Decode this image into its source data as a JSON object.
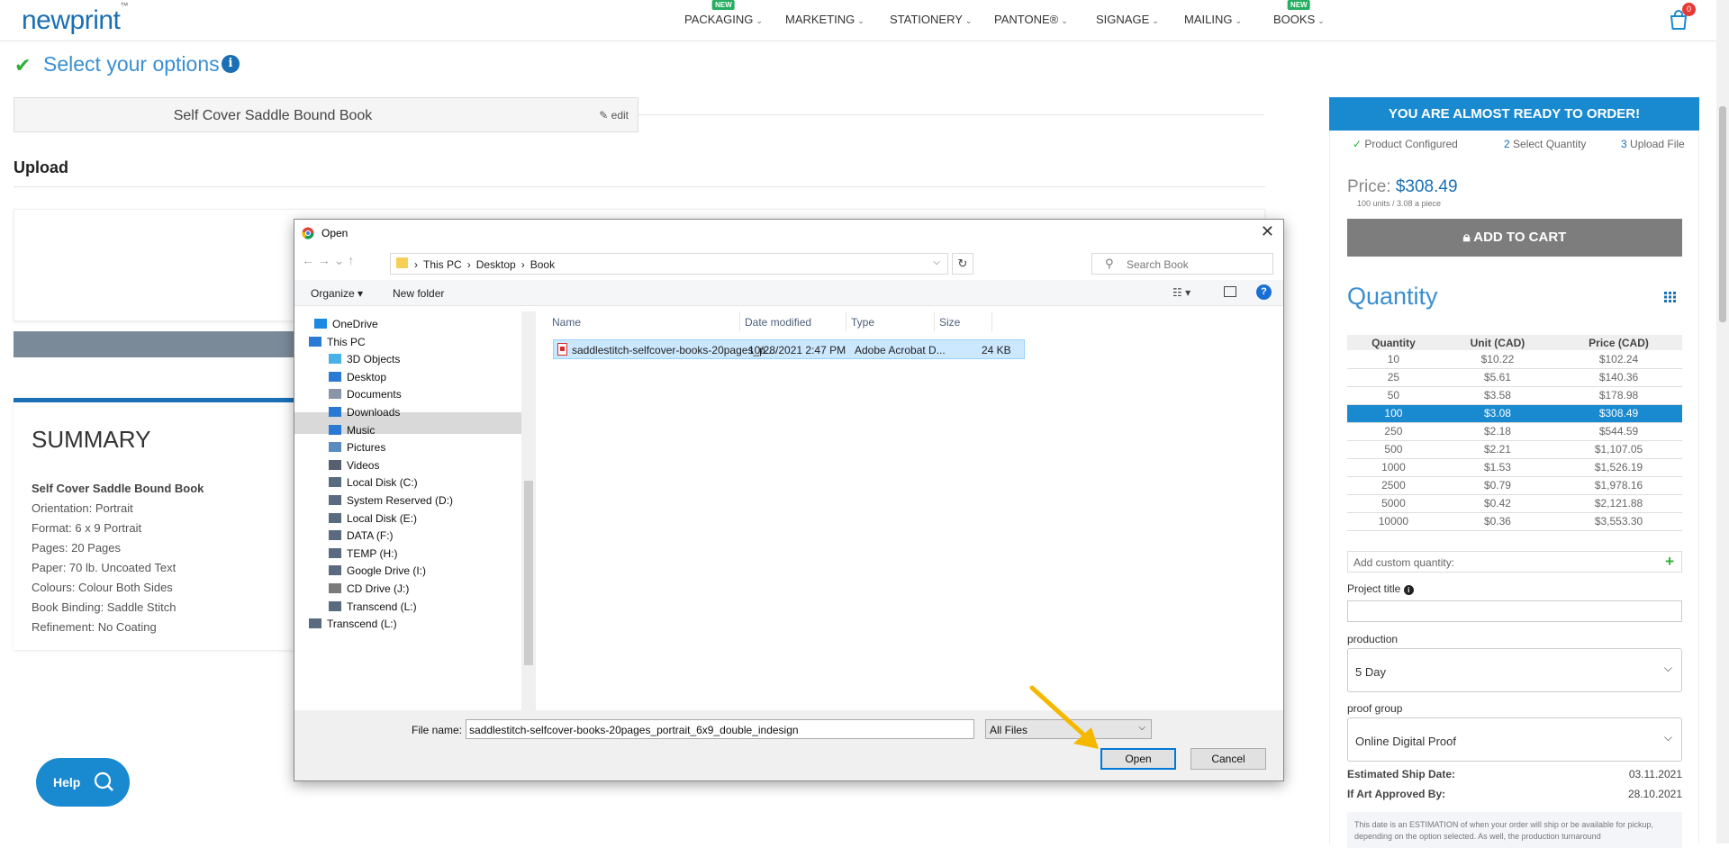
{
  "header": {
    "logo": "newprint",
    "logo_tm": "™",
    "nav": [
      {
        "label": "PACKAGING",
        "badge": "NEW"
      },
      {
        "label": "MARKETING",
        "badge": ""
      },
      {
        "label": "STATIONERY",
        "badge": ""
      },
      {
        "label": "PANTONE®",
        "badge": ""
      },
      {
        "label": "SIGNAGE",
        "badge": ""
      },
      {
        "label": "MAILING",
        "badge": ""
      },
      {
        "label": "BOOKS",
        "badge": "NEW"
      }
    ],
    "cart_count": "0",
    "chevron": "⌄"
  },
  "options": {
    "title": "Select your options",
    "info_glyph": "i",
    "product_name": "Self Cover Saddle Bound Book",
    "edit_label": "edit"
  },
  "upload": {
    "heading": "Upload"
  },
  "summary": {
    "heading": "SUMMARY",
    "lines": [
      "Self Cover Saddle Bound Book",
      "Orientation: Portrait",
      "Format: 6 x 9 Portrait",
      "Pages: 20 Pages",
      "Paper: 70 lb. Uncoated Text",
      "Colours: Colour Both Sides",
      "Book Binding: Saddle Stitch",
      "Refinement: No Coating"
    ]
  },
  "help": {
    "label": "Help"
  },
  "order": {
    "banner": "YOU ARE ALMOST READY TO ORDER!",
    "steps": [
      {
        "num": "✓",
        "label": "Product Configured"
      },
      {
        "num": "2",
        "label": "Select Quantity"
      },
      {
        "num": "3",
        "label": "Upload File"
      }
    ],
    "price_label": "Price:",
    "price_value": "$308.49",
    "price_sub": "100 units / 3.08 a piece",
    "add_to_cart": "ADD TO CART",
    "quantity_heading": "Quantity",
    "table_headers": [
      "Quantity",
      "Unit (CAD)",
      "Price (CAD)"
    ],
    "table_rows": [
      [
        "10",
        "$10.22",
        "$102.24"
      ],
      [
        "25",
        "$5.61",
        "$140.36"
      ],
      [
        "50",
        "$3.58",
        "$178.98"
      ],
      [
        "100",
        "$3.08",
        "$308.49"
      ],
      [
        "250",
        "$2.18",
        "$544.59"
      ],
      [
        "500",
        "$2.21",
        "$1,107.05"
      ],
      [
        "1000",
        "$1.53",
        "$1,526.19"
      ],
      [
        "2500",
        "$0.79",
        "$1,978.16"
      ],
      [
        "5000",
        "$0.42",
        "$2,121.88"
      ],
      [
        "10000",
        "$0.36",
        "$3,553.30"
      ]
    ],
    "selected_quantity": "100",
    "custom_quantity_placeholder": "Add custom quantity:",
    "custom_plus": "+",
    "project_title_label": "Project title",
    "project_title_info": "i",
    "production_label": "production",
    "production_value": "5 Day",
    "proof_label": "proof group",
    "proof_value": "Online Digital Proof",
    "est_ship_label": "Estimated Ship Date:",
    "est_ship_value": "03.11.2021",
    "art_approved_label": "If Art Approved By:",
    "art_approved_value": "28.10.2021",
    "est_note": "This date is an ESTIMATION of when your order will ship or be available for pickup, depending on the option selected. As well, the production turnaround"
  },
  "dialog": {
    "title": "Open",
    "close": "✕",
    "nav_glyphs": "←  →  ⌄  ↑",
    "path": [
      "This PC",
      "Desktop",
      "Book"
    ],
    "path_sep": "›",
    "search_placeholder": "Search Book",
    "search_glyph": "⚲",
    "refresh_glyph": "↻",
    "organize": "Organize ▾",
    "new_folder": "New folder",
    "view_glyph": "☷ ▾",
    "help_glyph": "?",
    "tree": [
      {
        "label": "OneDrive",
        "icon": "cloud-icon",
        "color": "#1e88e5"
      },
      {
        "label": "This PC",
        "icon": "computer-icon",
        "color": "#2a7ad5"
      },
      {
        "label": "3D Objects",
        "icon": "cube-icon",
        "color": "#4ab0e8"
      },
      {
        "label": "Desktop",
        "icon": "desktop-icon",
        "color": "#2a7ad5"
      },
      {
        "label": "Documents",
        "icon": "document-icon",
        "color": "#8a96a8"
      },
      {
        "label": "Downloads",
        "icon": "download-icon",
        "color": "#2a7ad5"
      },
      {
        "label": "Music",
        "icon": "music-icon",
        "color": "#2a7ad5"
      },
      {
        "label": "Pictures",
        "icon": "pictures-icon",
        "color": "#5a8ac0"
      },
      {
        "label": "Videos",
        "icon": "videos-icon",
        "color": "#556070"
      },
      {
        "label": "Local Disk (C:)",
        "icon": "disk-icon",
        "color": "#5a6a80"
      },
      {
        "label": "System Reserved (D:)",
        "icon": "disk-icon",
        "color": "#5a6a80"
      },
      {
        "label": "Local Disk (E:)",
        "icon": "disk-icon",
        "color": "#5a6a80"
      },
      {
        "label": "DATA (F:)",
        "icon": "disk-icon",
        "color": "#5a6a80"
      },
      {
        "label": "TEMP (H:)",
        "icon": "disk-icon",
        "color": "#5a6a80"
      },
      {
        "label": "Google Drive (I:)",
        "icon": "disk-icon",
        "color": "#5a6a80"
      },
      {
        "label": "CD Drive (J:)",
        "icon": "cd-icon",
        "color": "#7a7a7a"
      },
      {
        "label": "Transcend (L:)",
        "icon": "disk-icon",
        "color": "#5a6a80"
      },
      {
        "label": "Transcend (L:)",
        "icon": "disk-icon",
        "color": "#5a6a80"
      }
    ],
    "selected_tree_item": "Desktop",
    "columns": [
      "Name",
      "Date modified",
      "Type",
      "Size"
    ],
    "file": {
      "name": "saddlestitch-selfcover-books-20pages_p...",
      "date": "10/28/2021 2:47 PM",
      "type": "Adobe Acrobat D...",
      "size": "24 KB"
    },
    "file_name_label": "File name:",
    "file_name_value": "saddlestitch-selfcover-books-20pages_portrait_6x9_double_indesign",
    "file_type": "All Files",
    "open_label": "Open",
    "cancel_label": "Cancel"
  },
  "colors": {
    "accent": "#1a8ad0",
    "brand": "#1a6fb5",
    "success": "#2eb135",
    "arrow": "#f5b800"
  }
}
